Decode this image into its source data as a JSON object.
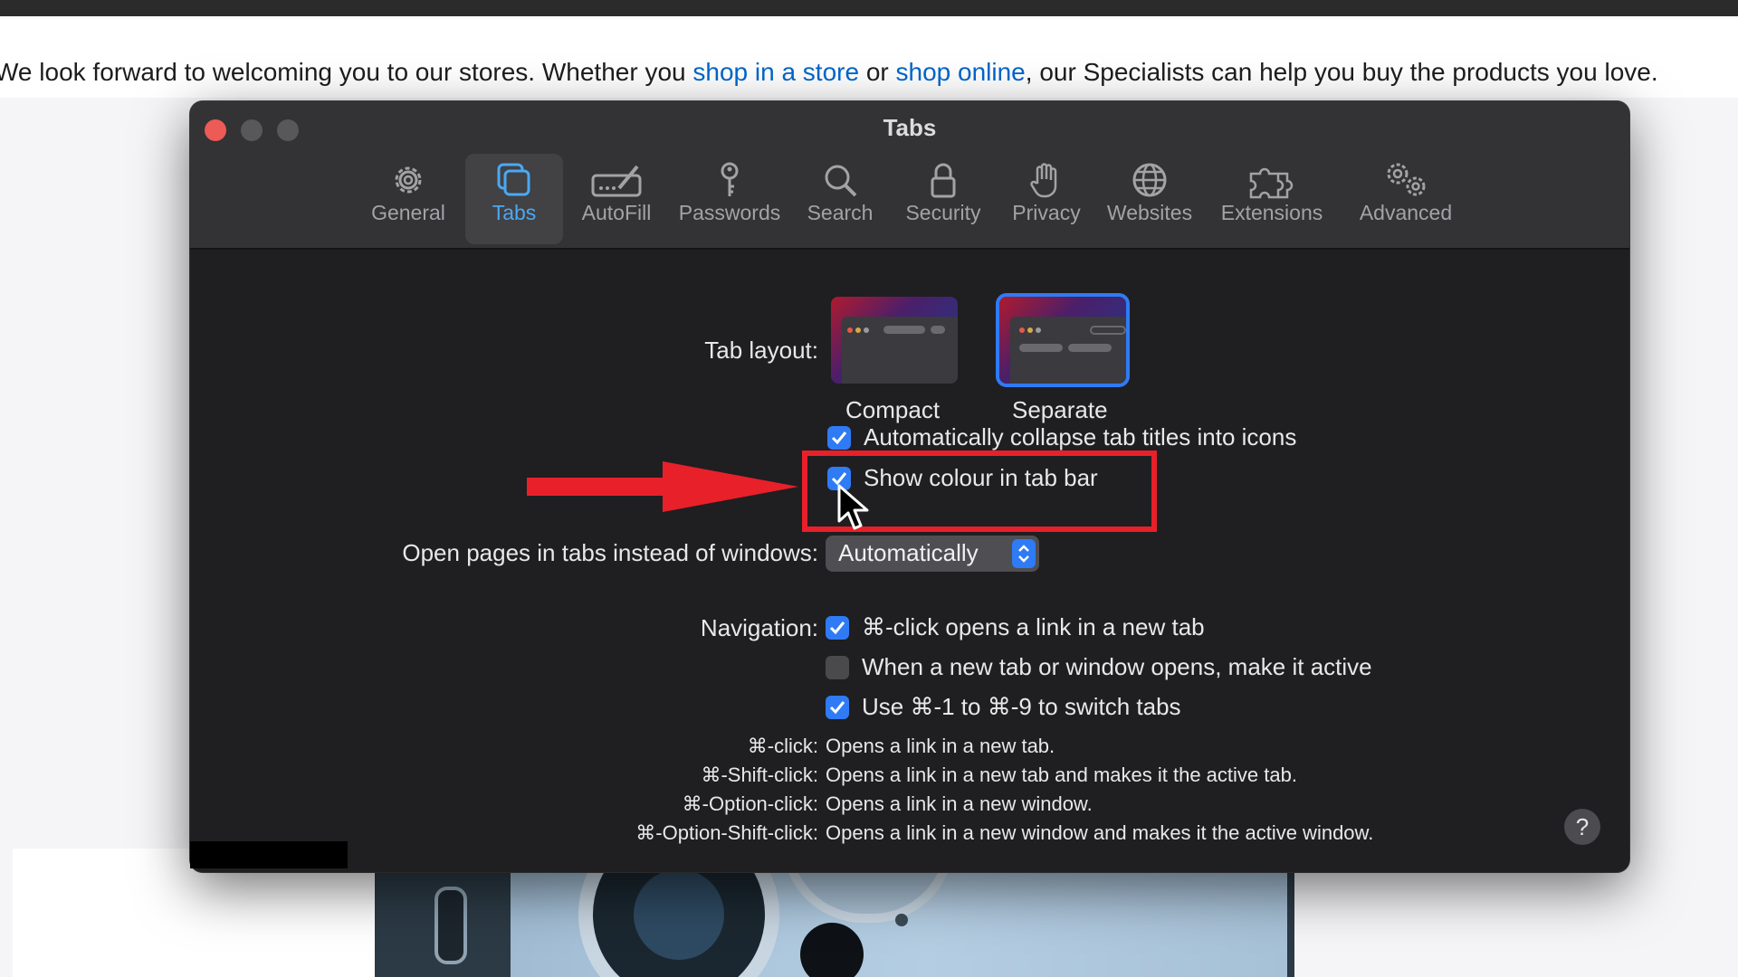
{
  "webpage": {
    "banner_pre": "We look forward to welcoming you to our stores. Whether you ",
    "link1": "shop in a store",
    "banner_mid": " or ",
    "link2": "shop online",
    "banner_post": ", our Specialists can help you buy the products you love."
  },
  "window": {
    "title": "Tabs",
    "toolbar": [
      {
        "label": "General",
        "icon": "gear-icon",
        "active": false
      },
      {
        "label": "Tabs",
        "icon": "tabs-icon",
        "active": true
      },
      {
        "label": "AutoFill",
        "icon": "pencil-icon",
        "active": false
      },
      {
        "label": "Passwords",
        "icon": "key-icon",
        "active": false
      },
      {
        "label": "Search",
        "icon": "search-icon",
        "active": false
      },
      {
        "label": "Security",
        "icon": "lock-icon",
        "active": false
      },
      {
        "label": "Privacy",
        "icon": "hand-icon",
        "active": false
      },
      {
        "label": "Websites",
        "icon": "globe-icon",
        "active": false
      },
      {
        "label": "Extensions",
        "icon": "puzzle-icon",
        "active": false
      },
      {
        "label": "Advanced",
        "icon": "gears-icon",
        "active": false
      }
    ]
  },
  "tabs_pane": {
    "tab_layout_label": "Tab layout:",
    "layout_compact": "Compact",
    "layout_separate": "Separate",
    "selected_layout": "Separate",
    "collapse_titles": {
      "label": "Automatically collapse tab titles into icons",
      "checked": true
    },
    "show_colour": {
      "label": "Show colour in tab bar",
      "checked": true
    },
    "open_pages_label": "Open pages in tabs instead of windows:",
    "open_pages_value": "Automatically",
    "navigation_label": "Navigation:",
    "nav_options": [
      {
        "label": "⌘-click opens a link in a new tab",
        "checked": true
      },
      {
        "label": "When a new tab or window opens, make it active",
        "checked": false
      },
      {
        "label": "Use ⌘-1 to ⌘-9 to switch tabs",
        "checked": true
      }
    ],
    "shortcuts": [
      {
        "key": "⌘-click:",
        "desc": "Opens a link in a new tab."
      },
      {
        "key": "⌘-Shift-click:",
        "desc": "Opens a link in a new tab and makes it the active tab."
      },
      {
        "key": "⌘-Option-click:",
        "desc": "Opens a link in a new window."
      },
      {
        "key": "⌘-Option-Shift-click:",
        "desc": "Opens a link in a new window and makes it the active window."
      }
    ],
    "help": "?"
  },
  "colors": {
    "accent": "#2f7bf5",
    "tab_active": "#4aa9f2",
    "annotation_red": "#e8202a"
  }
}
